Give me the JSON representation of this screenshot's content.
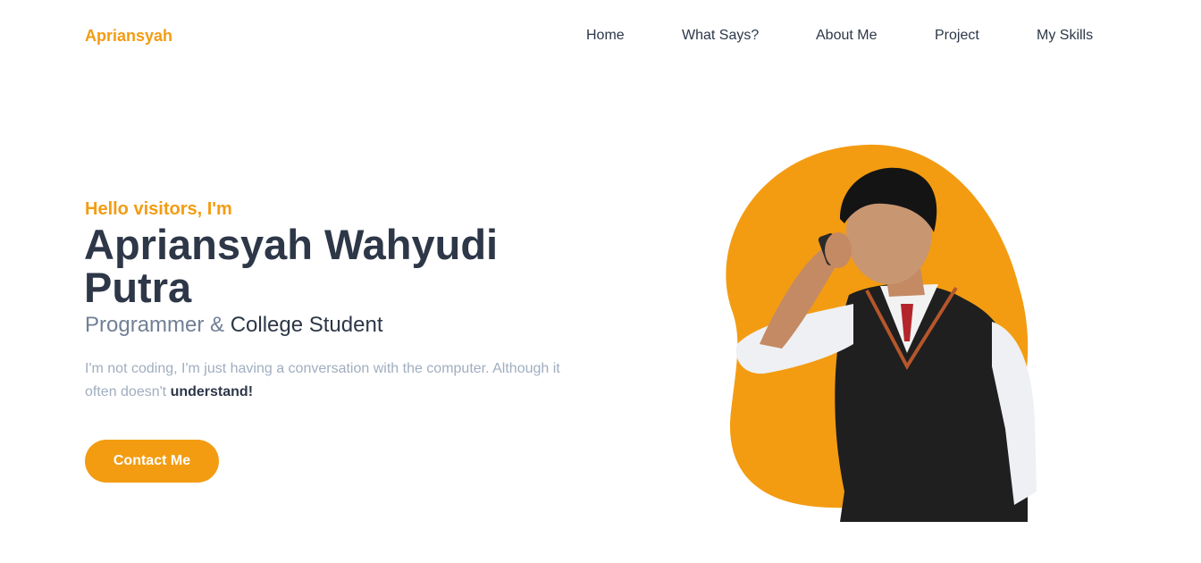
{
  "brand": {
    "logo_text": "Apriansyah",
    "color": "#f39c12"
  },
  "nav": {
    "items": [
      {
        "label": "Home"
      },
      {
        "label": "What Says?"
      },
      {
        "label": "About Me"
      },
      {
        "label": "Project"
      },
      {
        "label": "My Skills"
      }
    ]
  },
  "hero": {
    "greeting": "Hello visitors, I'm",
    "name": "Apriansyah Wahyudi Putra",
    "role_part1": "Programmer & ",
    "role_part2": "College Student",
    "description_part1": "I'm not coding, I'm just having a conversation with the computer. Although it often doesn't ",
    "description_bold": "understand!",
    "cta_label": "Contact Me",
    "accent_color": "#f39c12",
    "image_icon": "portrait-photo"
  }
}
